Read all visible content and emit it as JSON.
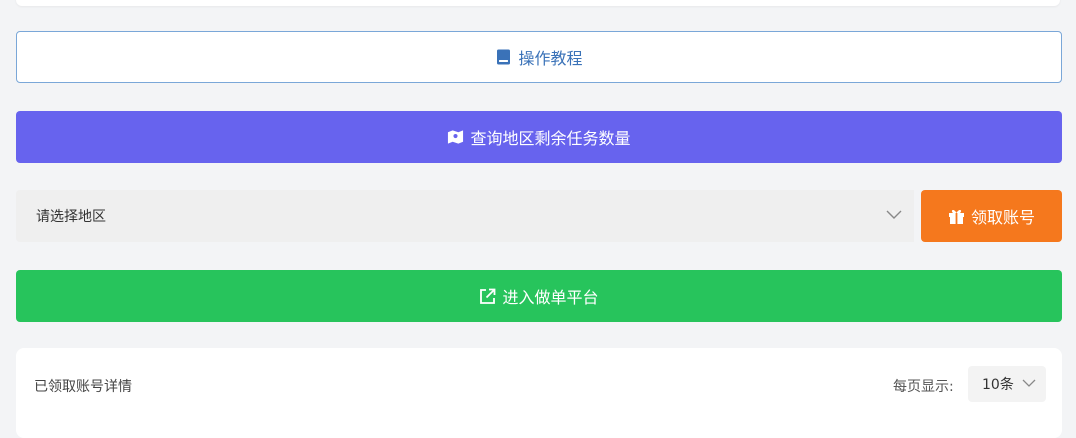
{
  "buttons": {
    "tutorial": {
      "label": "操作教程",
      "icon": "book-icon"
    },
    "query": {
      "label": "查询地区剩余任务数量",
      "icon": "map-icon"
    },
    "claim": {
      "label": "领取账号",
      "icon": "gift-icon"
    },
    "enter": {
      "label": "进入做单平台",
      "icon": "external-link-icon"
    }
  },
  "region_select": {
    "value": "请选择地区"
  },
  "detail": {
    "title": "已领取账号详情",
    "per_page_label": "每页显示:",
    "per_page_value": "10条"
  },
  "colors": {
    "tutorial_border": "#7aa7d8",
    "tutorial_text": "#3a72b8",
    "query_bg": "#6763ee",
    "claim_bg": "#f5781d",
    "enter_bg": "#27c45c"
  }
}
